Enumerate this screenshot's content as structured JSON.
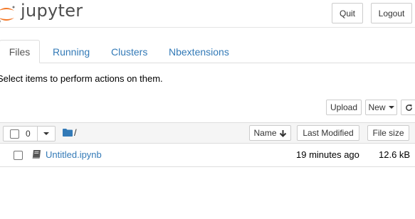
{
  "header": {
    "logo_text": "jupyter",
    "quit_label": "Quit",
    "logout_label": "Logout"
  },
  "tabs": [
    {
      "label": "Files",
      "active": true
    },
    {
      "label": "Running",
      "active": false
    },
    {
      "label": "Clusters",
      "active": false
    },
    {
      "label": "Nbextensions",
      "active": false
    }
  ],
  "hint": "Select items to perform actions on them.",
  "toolbar": {
    "upload_label": "Upload",
    "new_label": "New",
    "refresh_icon": "refresh-icon"
  },
  "list_header": {
    "selected_count": "0",
    "breadcrumb": "/",
    "sort_name_label": "Name",
    "sort_name_icon": "arrow-down-icon",
    "last_modified_label": "Last Modified",
    "file_size_label": "File size"
  },
  "items": [
    {
      "name": "Untitled.ipynb",
      "modified": "19 minutes ago",
      "size": "12.6 kB",
      "icon": "notebook-icon"
    }
  ],
  "colors": {
    "accent": "#337ab7",
    "logo_orange": "#f37726",
    "header_band": "#f5f5f5"
  }
}
